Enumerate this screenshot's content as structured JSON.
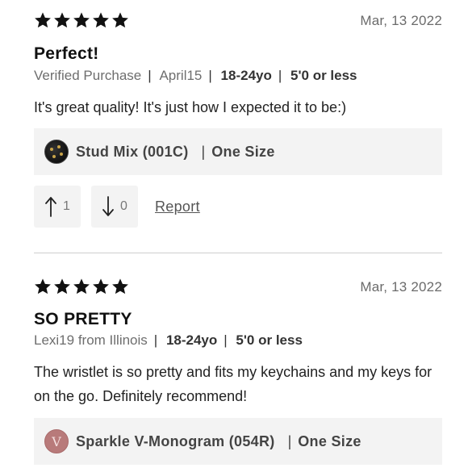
{
  "reviews": [
    {
      "rating": 5,
      "date": "Mar, 13 2022",
      "title": "Perfect!",
      "meta": [
        "Verified Purchase",
        "April15",
        "18-24yo",
        "5'0 or less"
      ],
      "body": "It's great quality! It's just how I expected it to be:)",
      "variant": {
        "name": "Stud Mix (001C)",
        "size": "One Size",
        "swatch_icon": "stud-mix-swatch"
      },
      "helpful_up": "1",
      "helpful_down": "0",
      "report_label": "Report"
    },
    {
      "rating": 5,
      "date": "Mar, 13 2022",
      "title": "SO PRETTY",
      "meta": [
        "Lexi19 from Illinois",
        "18-24yo",
        "5'0 or less"
      ],
      "body": "The wristlet is so pretty and fits my keychains and my keys for on the go. Definitely recommend!",
      "variant": {
        "name": "Sparkle V-Monogram (054R)",
        "size": "One Size",
        "swatch_icon": "v-monogram-swatch"
      }
    }
  ],
  "colors": {
    "star": "#111111",
    "variant_bg": "#f3f3f3",
    "divider": "#cfcfcf"
  }
}
